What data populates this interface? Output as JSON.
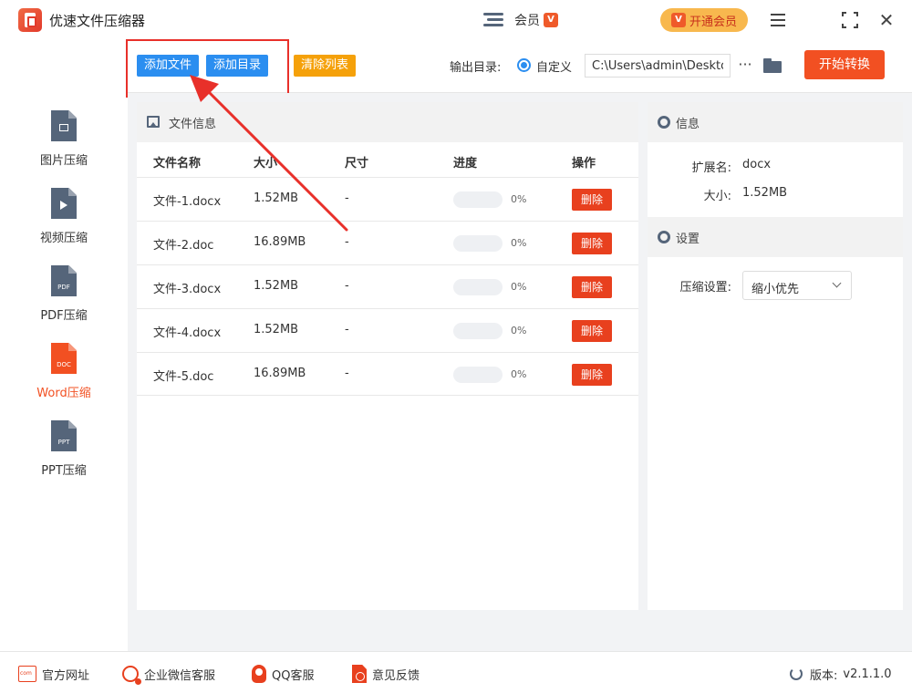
{
  "app": {
    "title": "优速文件压缩器"
  },
  "titlebar": {
    "user_name": "会员",
    "vip_badge": "V",
    "vip_button": "开通会员",
    "vip_crown": "V"
  },
  "toolbar": {
    "add_file": "添加文件",
    "add_dir": "添加目录",
    "clear_list": "清除列表",
    "output_label": "输出目录:",
    "radio_label": "自定义",
    "path_value": "C:\\Users\\admin\\Desktop",
    "more": "···",
    "start": "开始转换"
  },
  "sidebar": {
    "items": [
      {
        "label": "图片压缩",
        "tag": ""
      },
      {
        "label": "视频压缩",
        "tag": ""
      },
      {
        "label": "PDF压缩",
        "tag": "PDF"
      },
      {
        "label": "Word压缩",
        "tag": "DOC"
      },
      {
        "label": "PPT压缩",
        "tag": "PPT"
      }
    ],
    "active_index": 3
  },
  "file_panel": {
    "title": "文件信息",
    "columns": [
      "文件名称",
      "大小",
      "尺寸",
      "进度",
      "操作"
    ],
    "rows": [
      {
        "name": "文件-1.docx",
        "size": "1.52MB",
        "dim": "-",
        "progress": "0%",
        "action": "删除"
      },
      {
        "name": "文件-2.doc",
        "size": "16.89MB",
        "dim": "-",
        "progress": "0%",
        "action": "删除"
      },
      {
        "name": "文件-3.docx",
        "size": "1.52MB",
        "dim": "-",
        "progress": "0%",
        "action": "删除"
      },
      {
        "name": "文件-4.docx",
        "size": "1.52MB",
        "dim": "-",
        "progress": "0%",
        "action": "删除"
      },
      {
        "name": "文件-5.doc",
        "size": "16.89MB",
        "dim": "-",
        "progress": "0%",
        "action": "删除"
      }
    ]
  },
  "info_panel": {
    "info_title": "信息",
    "ext_label": "扩展名:",
    "ext_value": "docx",
    "size_label": "大小:",
    "size_value": "1.52MB",
    "settings_title": "设置",
    "compress_label": "压缩设置:",
    "compress_value": "缩小优先"
  },
  "footer": {
    "website": "官方网址",
    "wechat": "企业微信客服",
    "qq": "QQ客服",
    "feedback": "意见反馈",
    "version_label": "版本:",
    "version": "v2.1.1.0"
  },
  "colors": {
    "accent": "#2b8ef0",
    "danger": "#f25022",
    "warning": "#f5a10a",
    "vip": "#f8b84e"
  }
}
